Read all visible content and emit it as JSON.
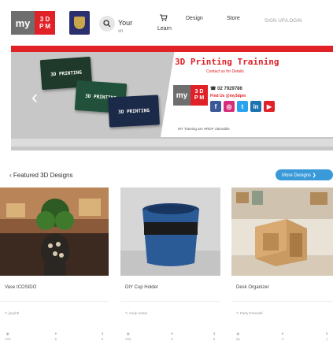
{
  "header": {
    "logo": {
      "my": "my",
      "letters": [
        "3",
        "D",
        "P",
        "M"
      ]
    },
    "search_icon": "search-icon",
    "nav_your": "Your",
    "nav_your_sub": "vn",
    "nav_learn": "Learn",
    "nav_design": "Design",
    "nav_store": "Store",
    "signin": "SIGN UP/LOGIN"
  },
  "banner": {
    "cards": [
      "3D PRINTING",
      "3D PRINTING",
      "3D PRINTING"
    ],
    "title": "3D Printing Training",
    "subtitle": "Contact us for Details",
    "phone": "02 7929786",
    "find_us": "Find Us @my3dpm",
    "footer": "MY Training are HRDF claimable",
    "social": [
      "f",
      "◎",
      "t",
      "in",
      "▶"
    ],
    "accent_color": "#e02127"
  },
  "featured": {
    "title": "Featured 3D Designs",
    "more_button": "More Designs ❯",
    "cards": [
      {
        "name": "Vase ICOSIDO",
        "author": "jayuhtl",
        "stats": [
          "275",
          "5",
          "5"
        ]
      },
      {
        "name": "DIY Cup Holder",
        "author": "Andy-nobot",
        "stats": [
          "225",
          "5",
          "5"
        ]
      },
      {
        "name": "Desk Organizer",
        "author": "Party Emerald",
        "stats": [
          "5k",
          "4",
          "1"
        ]
      }
    ]
  }
}
